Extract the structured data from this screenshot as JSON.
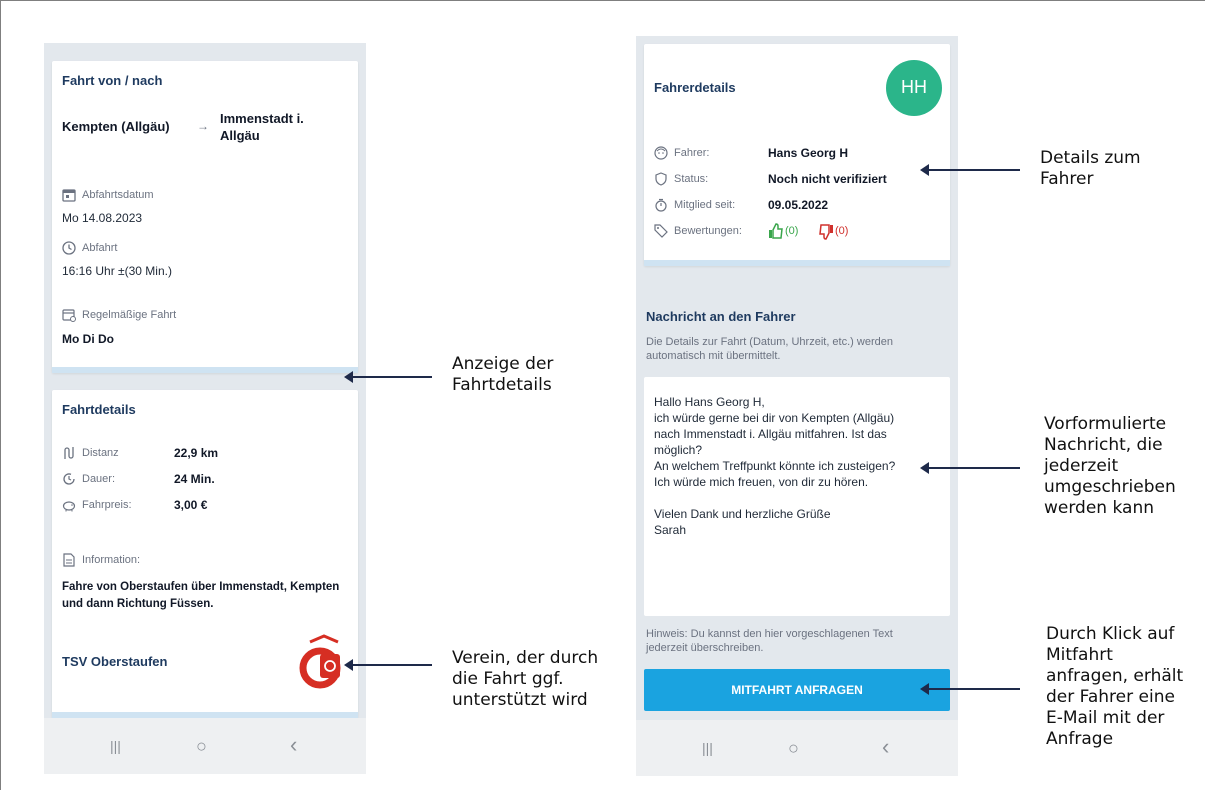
{
  "left_screen": {
    "route": {
      "title": "Fahrt von / nach",
      "from": "Kempten (Allgäu)",
      "to_line1": "Immenstadt i.",
      "to_line2": "Allgäu",
      "date_label": "Abfahrtsdatum",
      "date_value": "Mo 14.08.2023",
      "time_label": "Abfahrt",
      "time_value": "16:16 Uhr ±(30 Min.)",
      "regular_label": "Regelmäßige Fahrt",
      "regular_value": "Mo Di Do"
    },
    "details": {
      "title": "Fahrtdetails",
      "distance_label": "Distanz",
      "distance_value": "22,9 km",
      "duration_label": "Dauer:",
      "duration_value": "24 Min.",
      "price_label": "Fahrpreis:",
      "price_value": "3,00 €",
      "info_label": "Information:",
      "info_line1": "Fahre von Oberstaufen über Immenstadt, Kempten",
      "info_line2": "und dann Richtung Füssen.",
      "club_name": "TSV Oberstaufen"
    }
  },
  "right_screen": {
    "driver": {
      "title": "Fahrerdetails",
      "avatar_initials": "HH",
      "name_label": "Fahrer:",
      "name_value": "Hans Georg H",
      "status_label": "Status:",
      "status_value": "Noch nicht verifiziert",
      "member_label": "Mitglied seit:",
      "member_value": "09.05.2022",
      "ratings_label": "Bewertungen:",
      "ratings_positive": "(0)",
      "ratings_negative": "(0)"
    },
    "message": {
      "title": "Nachricht an den Fahrer",
      "hint_line1": "Die Details zur Fahrt (Datum, Uhrzeit, etc.) werden",
      "hint_line2": "automatisch mit übermittelt.",
      "lines": [
        "Hallo Hans Georg H,",
        "ich würde gerne bei dir von Kempten (Allgäu)",
        "nach Immenstadt i. Allgäu mitfahren. Ist das",
        "möglich?",
        "An welchem Treffpunkt könnte ich zusteigen?",
        "Ich würde mich freuen, von dir zu hören.",
        "",
        "Vielen Dank und herzliche Grüße",
        "Sarah"
      ],
      "note_line1": "Hinweis: Du kannst den hier vorgeschlagenen Text",
      "note_line2": "jederzeit überschreiben.",
      "button_label": "MITFAHRT ANFRAGEN"
    }
  },
  "nav": {
    "recent": "|||",
    "home": "○",
    "back": "‹"
  },
  "annotations": {
    "fahrtdetails": [
      "Anzeige der",
      "Fahrtdetails"
    ],
    "verein": [
      "Verein, der durch",
      "die Fahrt ggf.",
      "unterstützt wird"
    ],
    "fahrer": [
      "Details zum",
      "Fahrer"
    ],
    "nachricht": [
      "Vorformulierte",
      "Nachricht, die",
      "jederzeit",
      "umgeschrieben",
      "werden kann"
    ],
    "anfrage": [
      "Durch Klick auf",
      "Mitfahrt",
      "anfragen, erhält",
      "der Fahrer eine",
      "E-Mail mit der",
      "Anfrage"
    ]
  },
  "colors": {
    "avatar": "#2bb58a",
    "button": "#1aa3e0",
    "thumb_up": "#3aa64c",
    "thumb_down": "#d0312d",
    "club_logo": "#d62e23",
    "heading": "#1e3a5f"
  }
}
